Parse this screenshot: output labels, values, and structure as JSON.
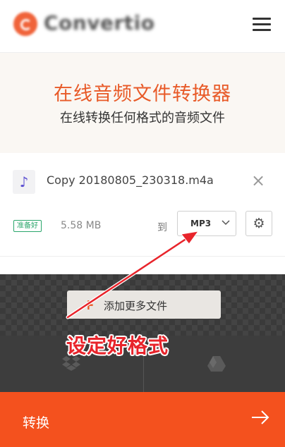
{
  "header": {
    "logo_text": "Convertio",
    "menu_icon": "hamburger-menu-icon"
  },
  "hero": {
    "title": "在线音频文件转换器",
    "subtitle": "在线转换任何格式的音频文件"
  },
  "file": {
    "icon": "music-note-icon",
    "name": "Copy 20180805_230318.m4a",
    "status": "准备好",
    "size": "5.58 MB",
    "to_label": "到",
    "format": "MP3",
    "remove_icon": "close-icon",
    "settings_icon": "gear-icon"
  },
  "upload": {
    "add_files_label": "添加更多文件",
    "sources": [
      "dropbox-icon",
      "google-drive-icon"
    ]
  },
  "convert": {
    "label": "转换",
    "arrow_icon": "arrow-right-icon"
  },
  "annotation": {
    "text": "设定好格式",
    "color": "#e8242b"
  },
  "colors": {
    "brand": "#f4511e",
    "title": "#e85a28",
    "ready": "#2aa66b"
  }
}
